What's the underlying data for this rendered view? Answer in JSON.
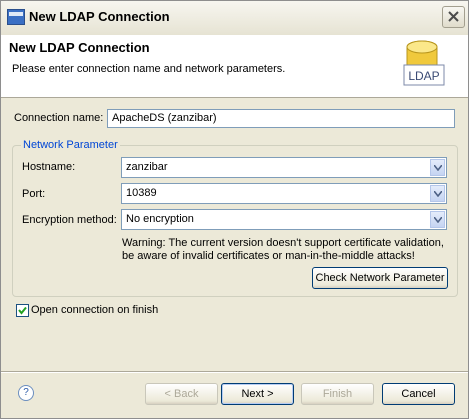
{
  "window": {
    "title": "New LDAP Connection",
    "close_icon": "close-icon",
    "app_icon": "eclipse-window-icon"
  },
  "banner": {
    "title": "New LDAP Connection",
    "description": "Please enter connection name and network parameters.",
    "icon": "ldap-database-icon",
    "icon_text": "LDAP"
  },
  "form": {
    "connection_name_label": "Connection name:",
    "connection_name_value": "ApacheDS (zanzibar)"
  },
  "network": {
    "legend": "Network Parameter",
    "hostname_label": "Hostname:",
    "hostname_value": "zanzibar",
    "port_label": "Port:",
    "port_value": "10389",
    "encryption_label": "Encryption method:",
    "encryption_value": "No encryption",
    "warning_line1": "Warning: The current version doesn't support certificate validation,",
    "warning_line2": "be aware of invalid certificates or man-in-the-middle attacks!",
    "check_button": "Check Network Parameter"
  },
  "options": {
    "open_on_finish_label": "Open connection on finish",
    "open_on_finish_checked": true
  },
  "footer": {
    "help_icon": "help-icon",
    "help_glyph": "?",
    "back_label": "< Back",
    "next_label": "Next >",
    "finish_label": "Finish",
    "cancel_label": "Cancel"
  },
  "colors": {
    "legend": "#0046d5",
    "dialog_bg": "#ece9d8",
    "field_border": "#7f9db9"
  }
}
